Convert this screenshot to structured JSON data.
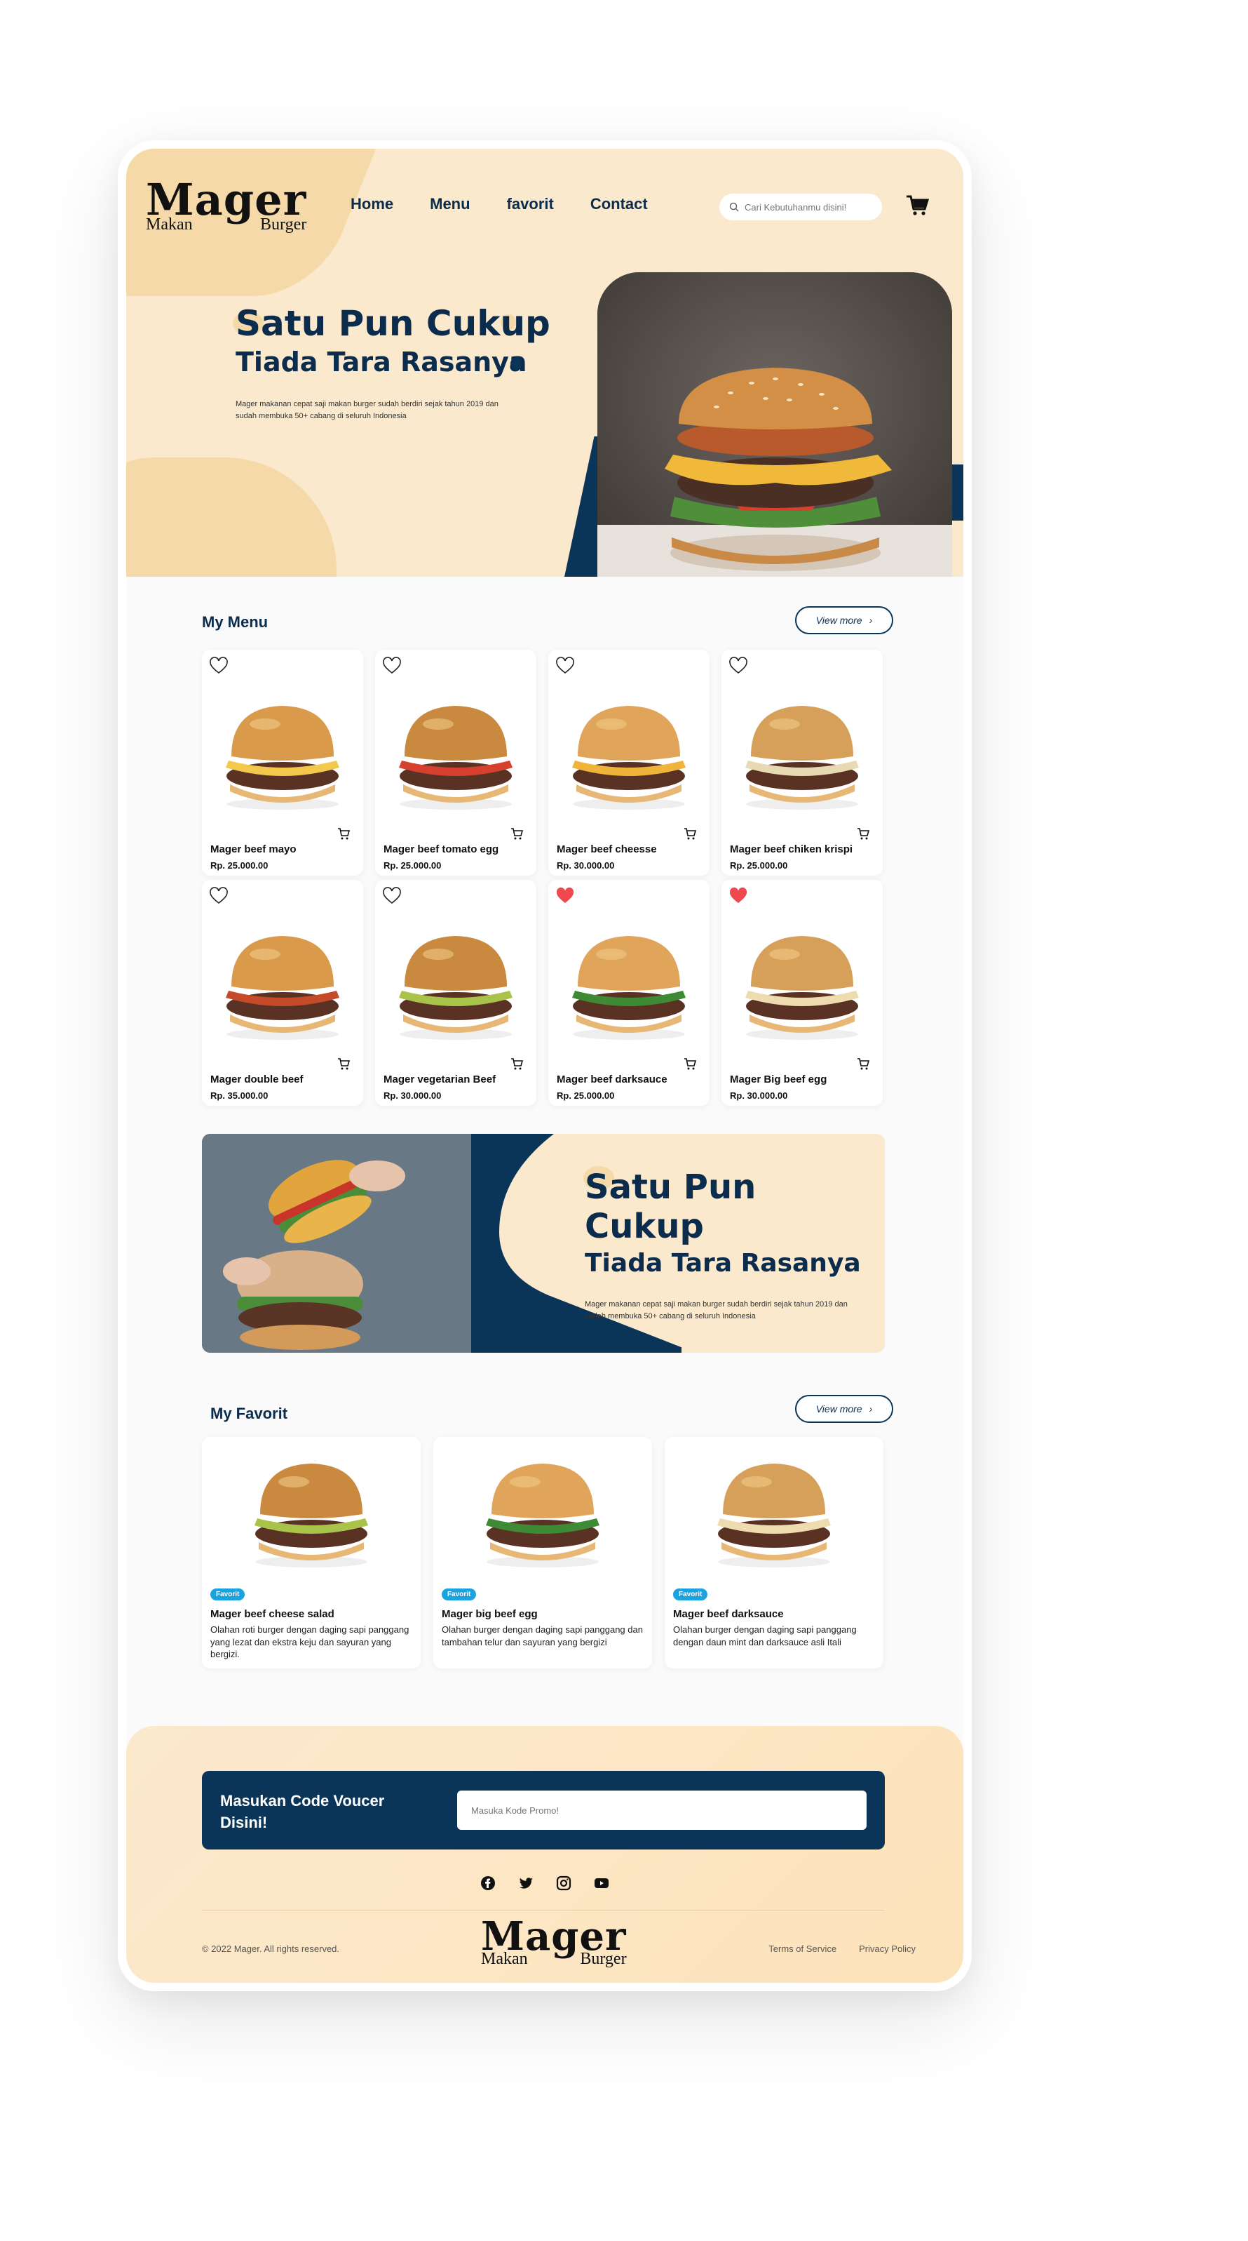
{
  "brand": {
    "name": "Mager",
    "sub_left": "Makan",
    "sub_right": "Burger"
  },
  "nav": {
    "items": [
      "Home",
      "Menu",
      "favorit",
      "Contact"
    ]
  },
  "search": {
    "placeholder": "Cari Kebutuhanmu disini!"
  },
  "hero": {
    "title": "Satu Pun Cukup",
    "subtitle": "Tiada Tara Rasanya",
    "description": "Mager makanan cepat saji makan burger sudah berdiri sejak tahun 2019 dan sudah membuka 50+ cabang di seluruh Indonesia"
  },
  "menu": {
    "title": "My Menu",
    "view_more": "View more",
    "items": [
      {
        "name": "Mager beef mayo",
        "price": "Rp. 25.000.00",
        "favorite": false
      },
      {
        "name": "Mager beef tomato egg",
        "price": "Rp. 25.000.00",
        "favorite": false
      },
      {
        "name": "Mager beef cheesse",
        "price": "Rp. 30.000.00",
        "favorite": false
      },
      {
        "name": "Mager beef chiken krispi",
        "price": "Rp. 25.000.00",
        "favorite": false
      },
      {
        "name": "Mager double beef",
        "price": "Rp. 35.000.00",
        "favorite": false
      },
      {
        "name": "Mager vegetarian Beef",
        "price": "Rp. 30.000.00",
        "favorite": false
      },
      {
        "name": "Mager beef darksauce",
        "price": "Rp. 25.000.00",
        "favorite": true
      },
      {
        "name": "Mager Big beef egg",
        "price": "Rp. 30.000.00",
        "favorite": true
      }
    ]
  },
  "banner": {
    "title": "Satu Pun Cukup",
    "subtitle": "Tiada Tara Rasanya",
    "description": "Mager makanan cepat saji makan burger sudah berdiri sejak tahun 2019 dan sudah membuka 50+ cabang di seluruh Indonesia"
  },
  "favorites": {
    "title": "My Favorit",
    "view_more": "View more",
    "items": [
      {
        "badge": "Favorit",
        "name": "Mager beef cheese salad",
        "description": "Olahan roti burger dengan daging sapi panggang yang lezat dan ekstra keju dan sayuran yang bergizi."
      },
      {
        "badge": "Favorit",
        "name": "Mager big beef egg",
        "description": "Olahan burger dengan daging sapi panggang dan tambahan telur dan sayuran yang bergizi"
      },
      {
        "badge": "Favorit",
        "name": "Mager beef darksauce",
        "description": "Olahan burger dengan daging sapi panggang dengan daun mint dan darksauce asli Itali"
      }
    ]
  },
  "footer": {
    "voucher_label": "Masukan Code Voucer Disini!",
    "voucher_placeholder": "Masuka Kode Promo!",
    "copyright": "© 2022 Mager. All rights reserved.",
    "links": [
      "Terms of Service",
      "Privacy Policy"
    ],
    "socials": [
      "facebook-icon",
      "twitter-icon",
      "instagram-icon",
      "youtube-icon"
    ]
  },
  "colors": {
    "navy": "#0b3558",
    "cream": "#fbe9cd",
    "accent": "#f6d9a8",
    "heart": "#f0484f",
    "badge": "#1aa3e0"
  }
}
